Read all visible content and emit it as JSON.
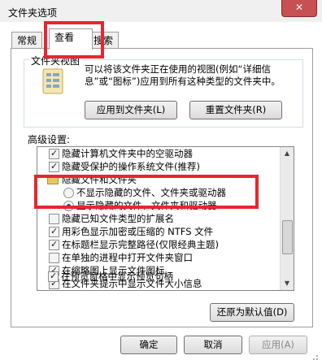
{
  "window": {
    "title": "文件夹选项",
    "close_glyph": "✕"
  },
  "tabs": [
    {
      "label": "常规",
      "active": false
    },
    {
      "label": "查看",
      "active": true
    },
    {
      "label": "搜索",
      "active": false
    }
  ],
  "folder_views": {
    "label": "文件夹视图",
    "description": "可以将该文件夹正在使用的视图(例如“详细信息”或“图标”)应用到所有这种类型的文件夹中。",
    "apply_button": "应用到文件夹(L)",
    "reset_button": "重置文件夹(R)"
  },
  "advanced": {
    "label": "高级设置:",
    "items": [
      {
        "type": "checkbox",
        "checked": true,
        "label": "隐藏计算机文件夹中的空驱动器"
      },
      {
        "type": "checkbox",
        "checked": true,
        "label": "隐藏受保护的操作系统文件(推荐)"
      },
      {
        "type": "folder",
        "label": "隐藏文件和文件夹"
      },
      {
        "type": "radio",
        "checked": false,
        "label": "不显示隐藏的文件、文件夹或驱动器"
      },
      {
        "type": "radio",
        "checked": true,
        "label": "显示隐藏的文件、文件夹和驱动器"
      },
      {
        "type": "checkbox",
        "checked": false,
        "label": "隐藏已知文件类型的扩展名"
      },
      {
        "type": "checkbox",
        "checked": true,
        "label": "用彩色显示加密或压缩的 NTFS 文件"
      },
      {
        "type": "checkbox",
        "checked": true,
        "label": "在标题栏显示完整路径(仅限经典主题)"
      },
      {
        "type": "checkbox",
        "checked": false,
        "label": "在单独的进程中打开文件夹窗口"
      },
      {
        "type": "checkbox",
        "checked": true,
        "label": "在缩略图上显示文件图标"
      },
      {
        "type": "checkbox",
        "checked": true,
        "label": "在文件夹提示中显示文件大小信息"
      },
      {
        "type": "checkbox",
        "checked": true,
        "label": "在预览窗格中显示预览句柄"
      }
    ],
    "restore_button": "还原为默认值(D)"
  },
  "footer": {
    "ok": "确定",
    "cancel": "取消",
    "apply": "应用(A)"
  },
  "colors": {
    "highlight": "#e8262f"
  }
}
